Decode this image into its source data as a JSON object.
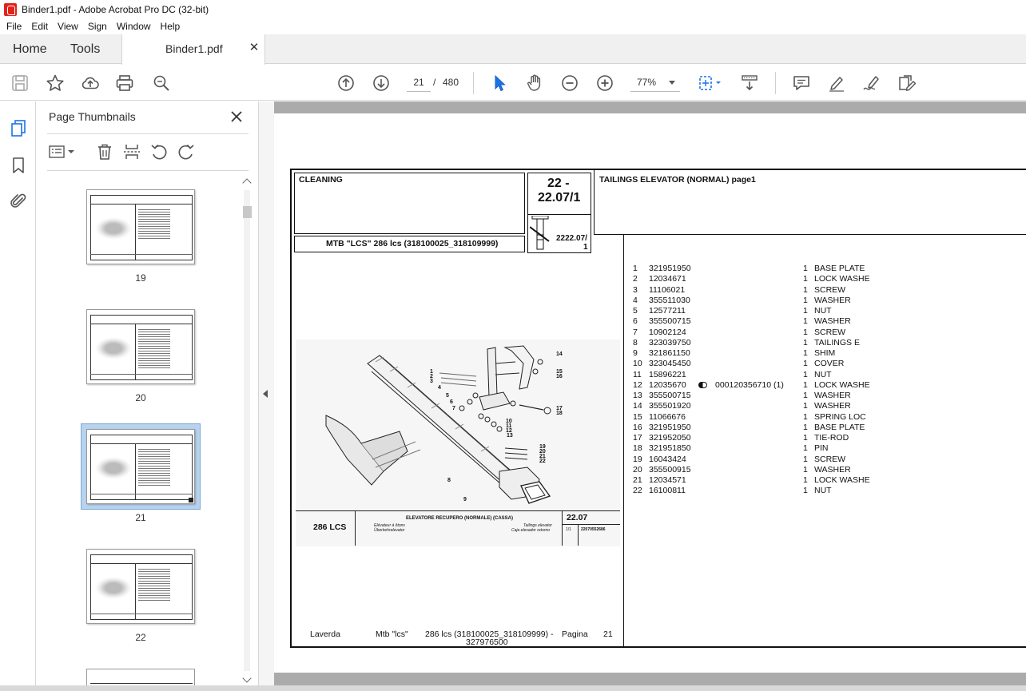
{
  "window": {
    "title": "Binder1.pdf - Adobe Acrobat Pro DC (32-bit)"
  },
  "menu": [
    "File",
    "Edit",
    "View",
    "Sign",
    "Window",
    "Help"
  ],
  "tabs": {
    "home": "Home",
    "tools": "Tools",
    "document": "Binder1.pdf"
  },
  "toolbar": {
    "current_page": "21",
    "page_separator": "/",
    "total_pages": "480",
    "zoom": "77%"
  },
  "thumbnails": {
    "title": "Page Thumbnails",
    "items": [
      {
        "label": "19"
      },
      {
        "label": "20"
      },
      {
        "label": "21",
        "selected": true
      },
      {
        "label": "22"
      }
    ]
  },
  "pdf": {
    "section": "CLEANING",
    "code_top": "22 -",
    "code_bottom": "22.07/1",
    "small_code": "2222.07/",
    "small_code_2": "1",
    "assembly_title": "TAILINGS ELEVATOR (NORMAL)  page1",
    "model_line": "MTB \"LCS\" 286 lcs (318100025_318109999)",
    "parts": [
      {
        "pos": "1",
        "code": "321951950",
        "note": "",
        "qty": "1",
        "desc": "BASE PLATE"
      },
      {
        "pos": "2",
        "code": "12034671",
        "note": "",
        "qty": "1",
        "desc": "LOCK WASHE"
      },
      {
        "pos": "3",
        "code": "11106021",
        "note": "",
        "qty": "1",
        "desc": "SCREW"
      },
      {
        "pos": "4",
        "code": "355511030",
        "note": "",
        "qty": "1",
        "desc": "WASHER"
      },
      {
        "pos": "5",
        "code": "12577211",
        "note": "",
        "qty": "1",
        "desc": "NUT"
      },
      {
        "pos": "6",
        "code": "355500715",
        "note": "",
        "qty": "1",
        "desc": "WASHER"
      },
      {
        "pos": "7",
        "code": "10902124",
        "note": "",
        "qty": "1",
        "desc": "SCREW"
      },
      {
        "pos": "8",
        "code": "323039750",
        "note": "",
        "qty": "1",
        "desc": "TAILINGS E"
      },
      {
        "pos": "9",
        "code": "321861150",
        "note": "",
        "qty": "1",
        "desc": "SHIM"
      },
      {
        "pos": "10",
        "code": "323045450",
        "note": "",
        "qty": "1",
        "desc": "COVER"
      },
      {
        "pos": "11",
        "code": "15896221",
        "note": "",
        "qty": "1",
        "desc": "NUT"
      },
      {
        "pos": "12",
        "code": "12035670",
        "note": "000120356710  (1)",
        "qty": "1",
        "desc": "LOCK WASHE"
      },
      {
        "pos": "13",
        "code": "355500715",
        "note": "",
        "qty": "1",
        "desc": "WASHER"
      },
      {
        "pos": "14",
        "code": "355501920",
        "note": "",
        "qty": "1",
        "desc": "WASHER"
      },
      {
        "pos": "15",
        "code": "11066676",
        "note": "",
        "qty": "1",
        "desc": "SPRING LOC"
      },
      {
        "pos": "16",
        "code": "321951950",
        "note": "",
        "qty": "1",
        "desc": "BASE PLATE"
      },
      {
        "pos": "17",
        "code": "321952050",
        "note": "",
        "qty": "1",
        "desc": "TIE-ROD"
      },
      {
        "pos": "18",
        "code": "321951850",
        "note": "",
        "qty": "1",
        "desc": "PIN"
      },
      {
        "pos": "19",
        "code": "16043424",
        "note": "",
        "qty": "1",
        "desc": "SCREW"
      },
      {
        "pos": "20",
        "code": "355500915",
        "note": "",
        "qty": "1",
        "desc": "WASHER"
      },
      {
        "pos": "21",
        "code": "12034571",
        "note": "",
        "qty": "1",
        "desc": "LOCK WASHE"
      },
      {
        "pos": "22",
        "code": "16100811",
        "note": "",
        "qty": "1",
        "desc": "NUT"
      }
    ],
    "drawing_callouts": [
      "1",
      "2",
      "3",
      "4",
      "5",
      "6",
      "7",
      "8",
      "9",
      "10",
      "11",
      "12",
      "13",
      "14",
      "15",
      "16",
      "17",
      "18",
      "19",
      "20",
      "21",
      "22"
    ],
    "caption": {
      "model": "286 LCS",
      "title_it": "ELEVATORE RECUPERO  (NORMALE) (CASSA)",
      "title_fr": "Elévateur à ôtons",
      "title_de": "Überkehrelevator",
      "title_en": "Tailings elevator",
      "title_es": "Caja elevador retorno",
      "table_code": "22.07",
      "sheet": "1/1",
      "drawing_no": "22070552686"
    },
    "footer": {
      "brand": "Laverda",
      "model": "Mtb \"lcs\"",
      "range": "286 lcs (318100025_318109999) -",
      "range_2": "327976500",
      "page_label": "Pagina",
      "page_no": "21"
    }
  }
}
